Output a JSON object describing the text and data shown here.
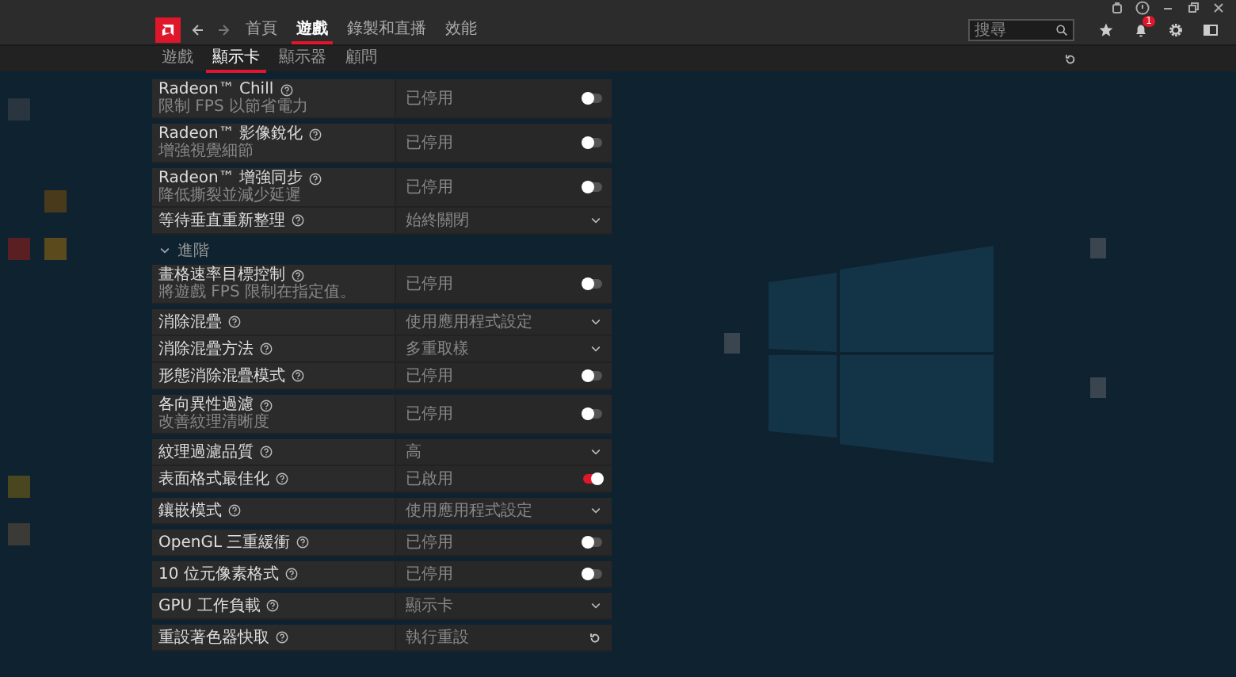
{
  "nav": {
    "items": [
      {
        "label": "首頁",
        "selected": false
      },
      {
        "label": "遊戲",
        "selected": true
      },
      {
        "label": "錄製和直播",
        "selected": false
      },
      {
        "label": "效能",
        "selected": false
      }
    ]
  },
  "search": {
    "placeholder": "搜尋"
  },
  "notifications": {
    "badge": "1"
  },
  "subnav": {
    "items": [
      {
        "label": "遊戲",
        "selected": false
      },
      {
        "label": "顯示卡",
        "selected": true
      },
      {
        "label": "顯示器",
        "selected": false
      },
      {
        "label": "顧問",
        "selected": false
      }
    ]
  },
  "blocks": [
    {
      "kind": "group",
      "rows": [
        {
          "label": "Radeon™ Chill",
          "description": "限制 FPS 以節省電力",
          "value": "已停用",
          "kind": "toggle",
          "on": false
        }
      ]
    },
    {
      "kind": "group",
      "rows": [
        {
          "label": "Radeon™ 影像銳化",
          "description": "增強視覺細節",
          "value": "已停用",
          "kind": "toggle",
          "on": false
        }
      ]
    },
    {
      "kind": "group",
      "rows": [
        {
          "label": "Radeon™ 增強同步",
          "description": "降低撕裂並減少延遲",
          "value": "已停用",
          "kind": "toggle",
          "on": false
        },
        {
          "label": "等待垂直重新整理",
          "value": "始終關閉",
          "kind": "dropdown"
        }
      ]
    },
    {
      "kind": "section",
      "label": "進階",
      "expanded": true
    },
    {
      "kind": "group",
      "rows": [
        {
          "label": "畫格速率目標控制",
          "description": "將遊戲 FPS 限制在指定值。",
          "value": "已停用",
          "kind": "toggle",
          "on": false
        }
      ]
    },
    {
      "kind": "group",
      "rows": [
        {
          "label": "消除混疊",
          "value": "使用應用程式設定",
          "kind": "dropdown"
        },
        {
          "label": "消除混疊方法",
          "value": "多重取樣",
          "kind": "dropdown"
        },
        {
          "label": "形態消除混疊模式",
          "value": "已停用",
          "kind": "toggle",
          "on": false
        }
      ]
    },
    {
      "kind": "group",
      "rows": [
        {
          "label": "各向異性過濾",
          "description": "改善紋理清晰度",
          "value": "已停用",
          "kind": "toggle",
          "on": false
        }
      ]
    },
    {
      "kind": "group",
      "rows": [
        {
          "label": "紋理過濾品質",
          "value": "高",
          "kind": "dropdown"
        },
        {
          "label": "表面格式最佳化",
          "value": "已啟用",
          "kind": "toggle",
          "on": true
        }
      ]
    },
    {
      "kind": "group",
      "rows": [
        {
          "label": "鑲嵌模式",
          "value": "使用應用程式設定",
          "kind": "dropdown"
        }
      ]
    },
    {
      "kind": "group",
      "rows": [
        {
          "label": "OpenGL 三重緩衝",
          "value": "已停用",
          "kind": "toggle",
          "on": false
        }
      ]
    },
    {
      "kind": "group",
      "rows": [
        {
          "label": "10 位元像素格式",
          "value": "已停用",
          "kind": "toggle",
          "on": false
        }
      ]
    },
    {
      "kind": "group",
      "rows": [
        {
          "label": "GPU 工作負載",
          "value": "顯示卡",
          "kind": "dropdown"
        }
      ]
    },
    {
      "kind": "group",
      "rows": [
        {
          "label": "重設著色器快取",
          "value": "執行重設",
          "kind": "action"
        }
      ]
    }
  ]
}
